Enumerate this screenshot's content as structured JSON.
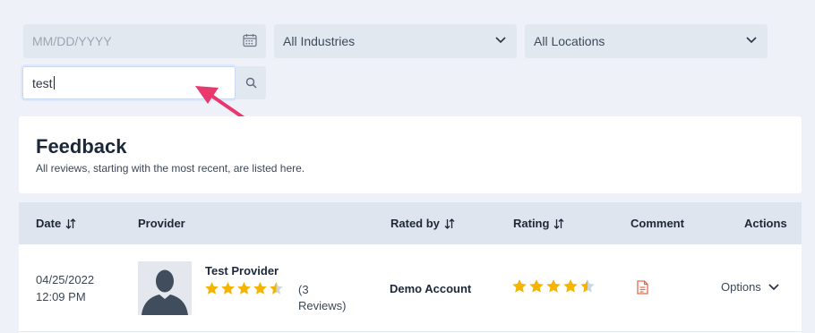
{
  "filters": {
    "date_placeholder": "MM/DD/YYYY",
    "industry": "All Industries",
    "location": "All Locations",
    "search_value": "test"
  },
  "header": {
    "title": "Feedback",
    "subtitle": "All reviews, starting with the most recent, are listed here."
  },
  "table": {
    "columns": {
      "date": "Date",
      "provider": "Provider",
      "rated_by": "Rated by",
      "rating": "Rating",
      "comment": "Comment",
      "actions": "Actions"
    },
    "rows": [
      {
        "date": "04/25/2022",
        "time": "12:09 PM",
        "provider_name": "Test Provider",
        "provider_rating": 4.5,
        "reviews_count_line1": "(3",
        "reviews_count_line2": "Reviews)",
        "rated_by": "Demo Account",
        "rating": 4.5,
        "options_label": "Options"
      }
    ]
  },
  "colors": {
    "star": "#f5b400",
    "star_empty": "#cfd5dd",
    "arrow": "#e8386d",
    "comment_icon": "#e56a4a"
  }
}
